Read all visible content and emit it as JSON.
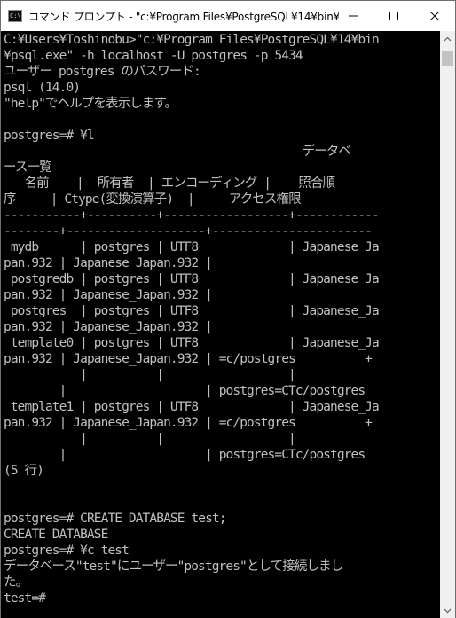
{
  "window": {
    "title": "コマンド プロンプト - \"c:¥Program Files¥PostgreSQL¥14¥bin¥psql.e...",
    "icon_text": "C:\\",
    "controls": {
      "minimize": "minimize-icon",
      "maximize": "maximize-icon",
      "close": "close-icon"
    }
  },
  "console": {
    "colors": {
      "background": "#000000",
      "text": "#c0c0c0"
    },
    "lines": [
      "C:¥Users¥Toshinobu>\"c:¥Program Files¥PostgreSQL¥14¥bin",
      "¥psql.exe\" -h localhost -U postgres -p 5434",
      "ユーザー postgres のパスワード:",
      "psql (14.0)",
      "\"help\"でヘルプを表示します。",
      "",
      "postgres=# ¥l",
      "                                           データベ",
      "ース一覧",
      "   名前    |  所有者  | エンコーディング |    照合順",
      "序     | Ctype(変換演算子)  |     アクセス権限",
      "-----------+----------+------------------+------------",
      "--------+--------------------+-----------------------",
      " mydb      | postgres | UTF8             | Japanese_Ja",
      "pan.932 | Japanese_Japan.932 |",
      " postgredb | postgres | UTF8             | Japanese_Ja",
      "pan.932 | Japanese_Japan.932 |",
      " postgres  | postgres | UTF8             | Japanese_Ja",
      "pan.932 | Japanese_Japan.932 |",
      " template0 | postgres | UTF8             | Japanese_Ja",
      "pan.932 | Japanese_Japan.932 | =c/postgres          +",
      "           |          |                  |",
      "        |                    | postgres=CTc/postgres",
      " template1 | postgres | UTF8             | Japanese_Ja",
      "pan.932 | Japanese_Japan.932 | =c/postgres          +",
      "           |          |                  |",
      "        |                    | postgres=CTc/postgres",
      "(5 行)",
      "",
      "",
      "postgres=# CREATE DATABASE test;",
      "CREATE DATABASE",
      "postgres=# ¥c test",
      "データベース\"test\"にユーザー\"postgres\"として接続しまし",
      "た。",
      "test=#"
    ]
  }
}
